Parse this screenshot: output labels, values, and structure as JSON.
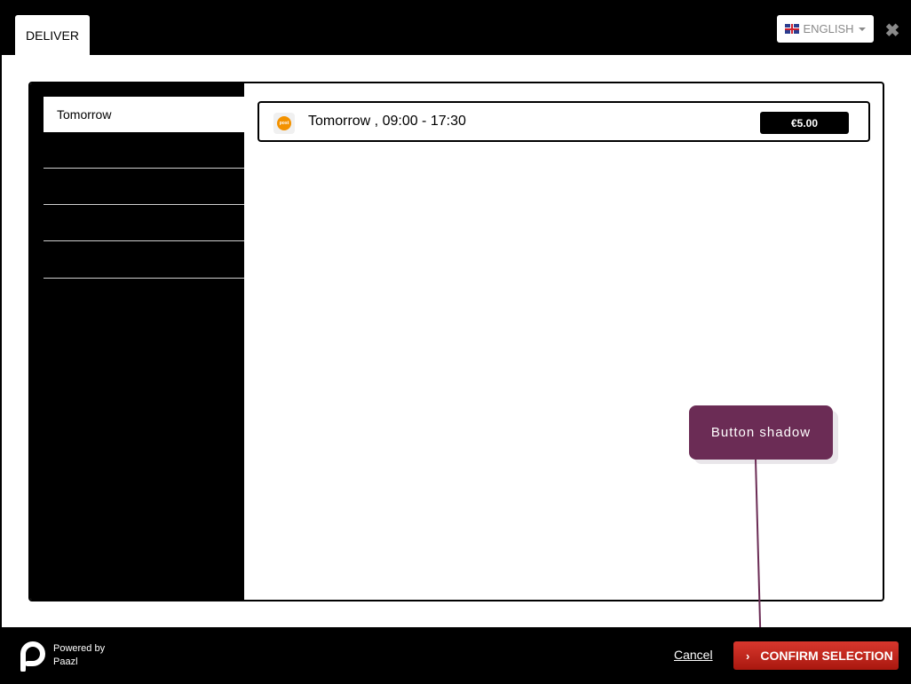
{
  "header": {
    "tab_label": "DELIVER",
    "language_label": "ENGLISH",
    "close_symbol": "✖"
  },
  "sidebar": {
    "items": [
      {
        "label": "Tomorrow",
        "active": true
      },
      {
        "label": ""
      },
      {
        "label": ""
      },
      {
        "label": ""
      },
      {
        "label": ""
      }
    ]
  },
  "options": [
    {
      "carrier_icon": "postnl-icon",
      "carrier_icon_text": "post",
      "label": "Tomorrow , 09:00 - 17:30",
      "price": "€5.00"
    }
  ],
  "annotation": {
    "text": "Button shadow",
    "color": "#6b2c55"
  },
  "footer": {
    "powered_line1": "Powered by",
    "powered_line2": "Paazl",
    "cancel_label": "Cancel",
    "confirm_label": "CONFIRM SELECTION",
    "confirm_color": "#c72a20"
  }
}
